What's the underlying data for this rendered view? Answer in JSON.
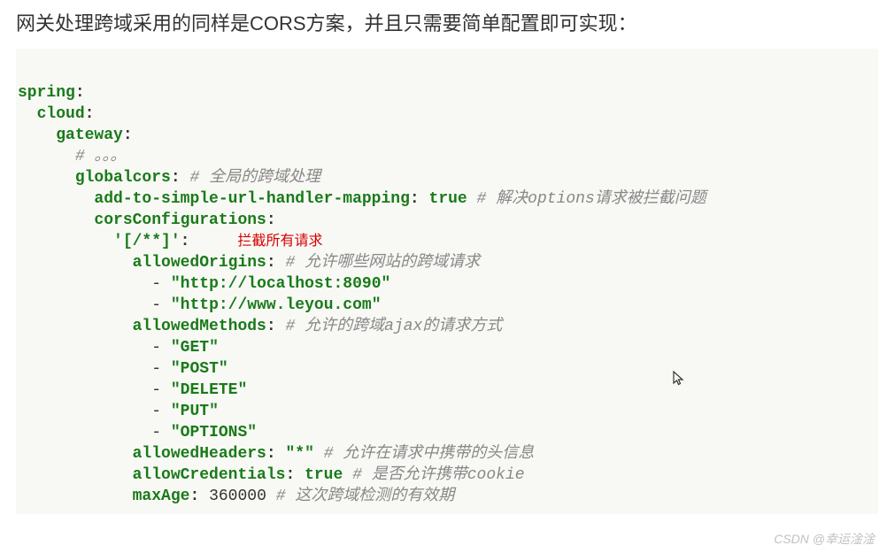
{
  "title": "网关处理跨域采用的同样是CORS方案，并且只需要简单配置即可实现：",
  "annotation": "拦截所有请求",
  "yaml": {
    "k1": "spring",
    "k2": "cloud",
    "k3": "gateway",
    "comment_dots": "# 。。。",
    "k4": "globalcors",
    "c4": "# 全局的跨域处理",
    "k5": "add-to-simple-url-handler-mapping",
    "v5": "true",
    "c5": "# 解决options请求被拦截问题",
    "k6": "corsConfigurations",
    "k7": "'[/**]'",
    "k8": "allowedOrigins",
    "c8": "# 允许哪些网站的跨域请求",
    "origins": [
      "\"http://localhost:8090\"",
      "\"http://www.leyou.com\""
    ],
    "k9": "allowedMethods",
    "c9": "# 允许的跨域ajax的请求方式",
    "methods": [
      "\"GET\"",
      "\"POST\"",
      "\"DELETE\"",
      "\"PUT\"",
      "\"OPTIONS\""
    ],
    "k10": "allowedHeaders",
    "v10": "\"*\"",
    "c10": "# 允许在请求中携带的头信息",
    "k11": "allowCredentials",
    "v11": "true",
    "c11": "# 是否允许携带cookie",
    "k12": "maxAge",
    "v12": "360000",
    "c12": "# 这次跨域检测的有效期"
  },
  "watermark": "CSDN @幸运淦淦"
}
